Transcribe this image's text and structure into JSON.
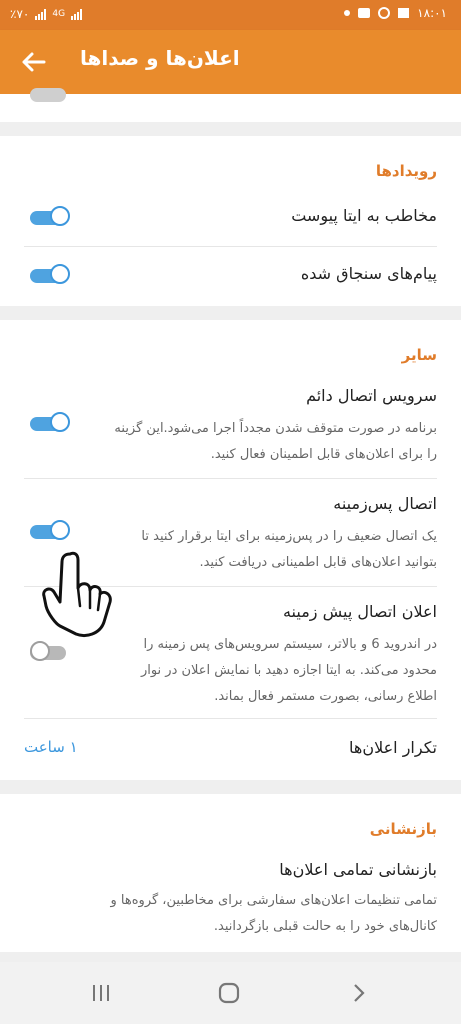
{
  "status_bar": {
    "time": "۱۸:۰۱",
    "battery": "٪۷۰",
    "network": "4G"
  },
  "app_bar": {
    "title": "اعلان‌ها و صداها",
    "back_icon": "arrow-left-icon"
  },
  "events": {
    "header": "رویدادها",
    "items": [
      {
        "label": "مخاطب به ایتا پیوست",
        "enabled": true
      },
      {
        "label": "پیام‌های سنجاق شده",
        "enabled": true
      }
    ]
  },
  "other": {
    "header": "سایر",
    "items": [
      {
        "label": "سرویس اتصال دائم",
        "desc_lines": [
          "برنامه در صورت متوقف شدن مجدداً اجرا می‌شود.این گزینه",
          "را برای اعلان‌های قابل اطمینان فعال کنید."
        ],
        "enabled": true
      },
      {
        "label": "اتصال پس‌زمینه",
        "desc_lines": [
          "یک اتصال ضعیف را در پس‌زمینه برای ایتا برقرار کنید تا",
          "بتوانید اعلان‌های قابل اطمینانی دریافت کنید."
        ],
        "enabled": true
      },
      {
        "label": "اعلان اتصال پیش زمینه",
        "desc_lines": [
          "در اندروید 6 و بالاتر، سیستم سرویس‌های پس زمینه را",
          "محدود می‌کند. به ایتا اجازه دهید با نمایش اعلان در نوار",
          "اطلاع رسانی، بصورت مستمر فعال بماند."
        ],
        "enabled": false
      }
    ],
    "repeat": {
      "label": "تکرار اعلان‌ها",
      "value": "۱ ساعت"
    }
  },
  "reset": {
    "header": "بازنشانی",
    "title": "بازنشانی تمامی اعلان‌ها",
    "desc_lines": [
      "تمامی تنظیمات اعلان‌های سفارشی برای مخاطبین، گروه‌ها و",
      "کانال‌های خود را به حالت قبلی بازگردانید."
    ]
  },
  "nav_bar": {
    "recents_icon": "recents-icon",
    "home_icon": "home-icon",
    "back_icon": "back-chevron-icon"
  },
  "colors": {
    "accent": "#e98b2c",
    "switch_on": "#4fa3e0",
    "link": "#3c97dd"
  },
  "overlay": {
    "pointer_icon": "hand-pointer-icon"
  }
}
